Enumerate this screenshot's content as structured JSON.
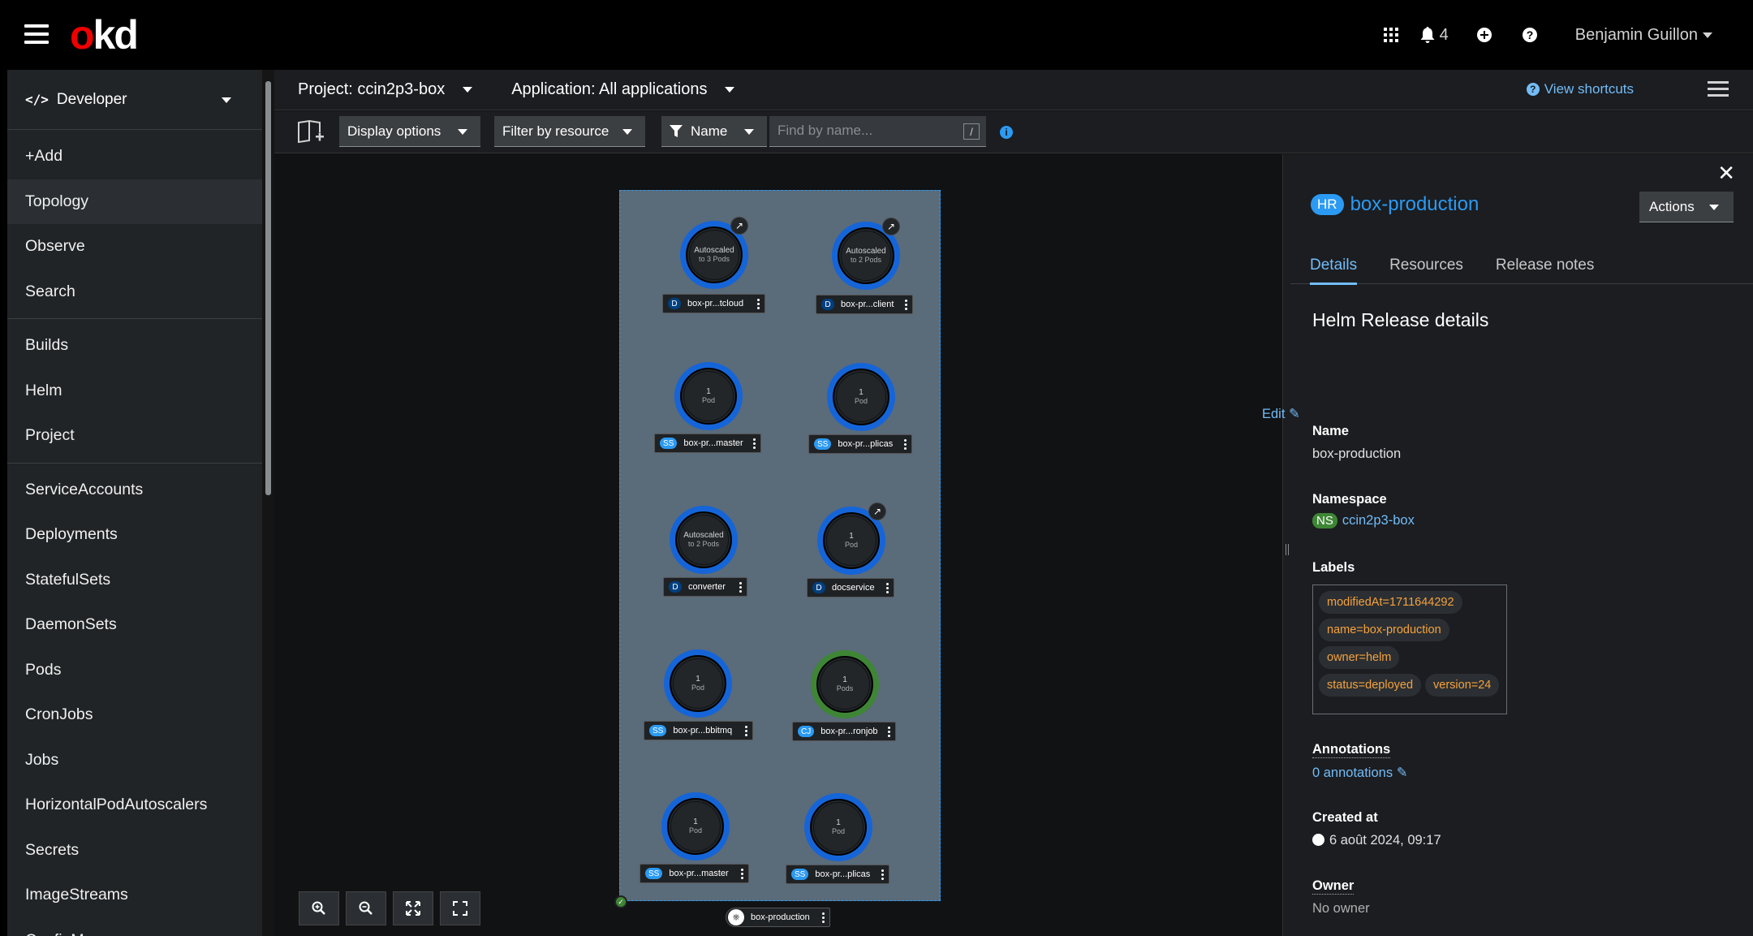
{
  "masthead": {
    "logo_o": "o",
    "logo_rest": "kd",
    "notification_count": "4",
    "user_name": "Benjamin Guillon"
  },
  "sidebar": {
    "perspective": "Developer",
    "items": [
      {
        "label": "+Add"
      },
      {
        "label": "Topology"
      },
      {
        "label": "Observe"
      },
      {
        "label": "Search"
      },
      {
        "label": "Builds"
      },
      {
        "label": "Helm"
      },
      {
        "label": "Project"
      },
      {
        "label": "ServiceAccounts"
      },
      {
        "label": "Deployments"
      },
      {
        "label": "StatefulSets"
      },
      {
        "label": "DaemonSets"
      },
      {
        "label": "Pods"
      },
      {
        "label": "CronJobs"
      },
      {
        "label": "Jobs"
      },
      {
        "label": "HorizontalPodAutoscalers"
      },
      {
        "label": "Secrets"
      },
      {
        "label": "ImageStreams"
      },
      {
        "label": "ConfigMaps"
      }
    ]
  },
  "projectbar": {
    "project": "Project: ccin2p3-box",
    "application": "Application: All applications",
    "view_shortcuts": "View shortcuts"
  },
  "toolbar": {
    "display_options": "Display options",
    "filter_by_resource": "Filter by resource",
    "filter_type": "Name",
    "search_placeholder": "Find by name...",
    "slash_hint": "/"
  },
  "topology": {
    "group_label": "box-production",
    "nodes": [
      {
        "line1": "Autoscaled",
        "line2": "to 3 Pods",
        "kind": "D",
        "name": "box-pr...tcloud"
      },
      {
        "line1": "Autoscaled",
        "line2": "to 2 Pods",
        "kind": "D",
        "name": "box-pr...client"
      },
      {
        "line1": "1",
        "line2": "Pod",
        "kind": "SS",
        "name": "box-pr...master"
      },
      {
        "line1": "1",
        "line2": "Pod",
        "kind": "SS",
        "name": "box-pr...plicas"
      },
      {
        "line1": "Autoscaled",
        "line2": "to 2 Pods",
        "kind": "D",
        "name": "converter"
      },
      {
        "line1": "1",
        "line2": "Pod",
        "kind": "D",
        "name": "docservice"
      },
      {
        "line1": "1",
        "line2": "Pod",
        "kind": "SS",
        "name": "box-pr...bbitmq"
      },
      {
        "line1": "1",
        "line2": "Pods",
        "kind": "CJ",
        "name": "box-pr...ronjob"
      },
      {
        "line1": "1",
        "line2": "Pod",
        "kind": "SS",
        "name": "box-pr...master"
      },
      {
        "line1": "1",
        "line2": "Pod",
        "kind": "SS",
        "name": "box-pr...plicas"
      }
    ]
  },
  "panel": {
    "badge": "HR",
    "title": "box-production",
    "actions": "Actions",
    "tabs": [
      {
        "label": "Details"
      },
      {
        "label": "Resources"
      },
      {
        "label": "Release notes"
      }
    ],
    "section_title": "Helm Release details",
    "name_label": "Name",
    "name_value": "box-production",
    "namespace_label": "Namespace",
    "ns_badge": "NS",
    "namespace_value": "ccin2p3-box",
    "labels_label": "Labels",
    "edit": "Edit",
    "labels": [
      "modifiedAt=1711644292",
      "name=box-production",
      "owner=helm",
      "status=deployed",
      "version=24"
    ],
    "annotations_label": "Annotations",
    "annotations_value": "0 annotations",
    "created_label": "Created at",
    "created_value": "6 août 2024, 09:17",
    "owner_label": "Owner",
    "owner_value": "No owner"
  },
  "colors": {
    "accent": "#2b9af3",
    "link": "#73bcf7",
    "label_text": "#f4a23d",
    "ring_blue": "#1565d8",
    "ring_green": "#3e8635",
    "logo_red": "#ee0000"
  }
}
